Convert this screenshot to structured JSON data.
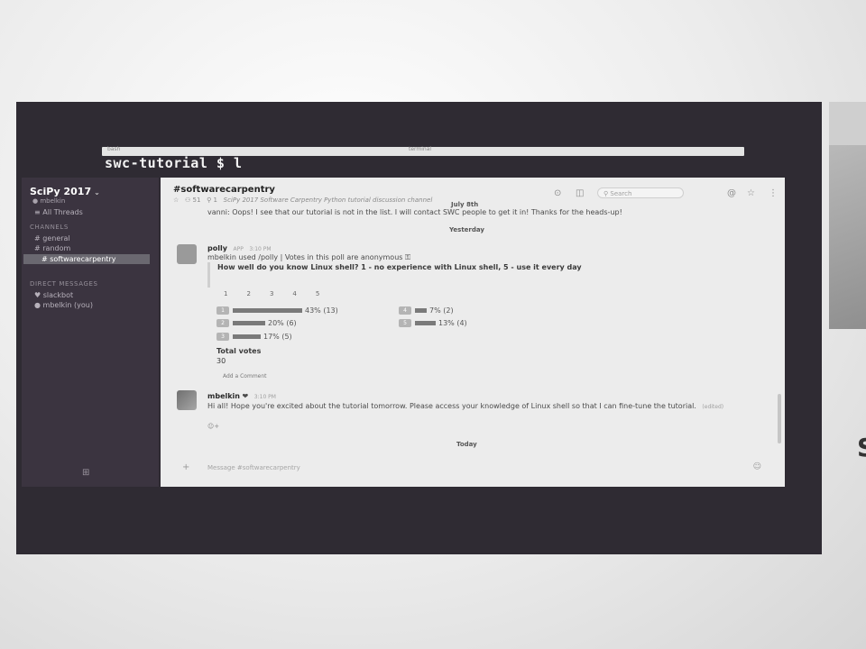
{
  "terminal": {
    "title_left": "bash",
    "title_mid": "terminal",
    "prompt": "swc-tutorial $ l"
  },
  "sidebar": {
    "team": "SciPy 2017",
    "user": "mbelkin",
    "all_threads": "All Threads",
    "channels_heading": "CHANNELS",
    "channels": [
      "general",
      "random",
      "softwarecarpentry"
    ],
    "dm_heading": "DIRECT MESSAGES",
    "dms": [
      "slackbot",
      "mbelkin (you)"
    ],
    "footer_icon": "grid-icon"
  },
  "header": {
    "channel": "#softwarecarpentry",
    "star": "☆",
    "members": "51",
    "pins": "1",
    "purpose": "SciPy 2017 Software Carpentry Python tutorial discussion channel",
    "search_placeholder": "Search"
  },
  "messages": {
    "date_july": "July 8th",
    "vanni_text": "vanni: Oops! I see that our tutorial is not in the list. I will contact SWC people to get it in! Thanks for the heads-up!",
    "date_yesterday": "Yesterday",
    "polly_author": "polly",
    "polly_app": "APP",
    "polly_time": "3:10 PM",
    "polly_line": "mbelkin used /polly | Votes in this poll are anonymous",
    "poll_question": "How well do you know Linux shell? 1 - no experience with Linux shell, 5 - use it every day",
    "option_numbers": [
      "1",
      "2",
      "3",
      "4",
      "5"
    ],
    "votes": [
      {
        "option": "1",
        "label": "43% (13)",
        "fraction": 0.43
      },
      {
        "option": "2",
        "label": "20% (6)",
        "fraction": 0.2
      },
      {
        "option": "3",
        "label": "17% (5)",
        "fraction": 0.17
      },
      {
        "option": "4",
        "label": "7% (2)",
        "fraction": 0.07
      },
      {
        "option": "5",
        "label": "13% (4)",
        "fraction": 0.13
      }
    ],
    "total_label": "Total votes",
    "total_value": "30",
    "add_comment": "Add a Comment",
    "mbelkin_author": "mbelkin",
    "mbelkin_time": "3:10 PM",
    "mbelkin_text": "Hi all! Hope you're excited about the tutorial tomorrow. Please access your knowledge of Linux shell so that I can fine-tune the tutorial.",
    "mbelkin_edited": "(edited)",
    "date_today": "Today"
  },
  "composer": {
    "placeholder": "Message #softwarecarpentry"
  }
}
